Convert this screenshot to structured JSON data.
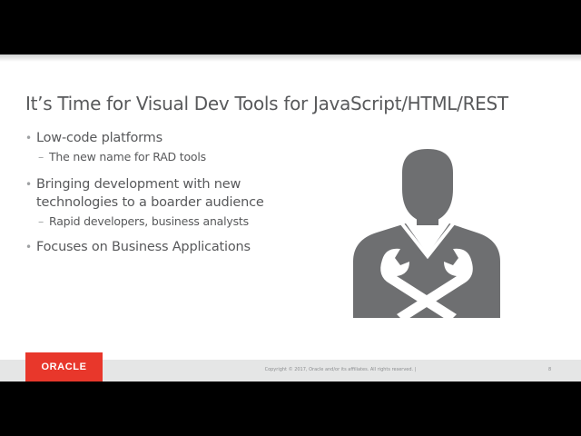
{
  "slide": {
    "title": "It’s Time for Visual Dev Tools for JavaScript/HTML/REST",
    "bullets": [
      {
        "text": "Low-code platforms",
        "sub": "The new name for RAD tools"
      },
      {
        "text_line1": "Bringing development with new",
        "text_line2": "technologies to a boarder audience",
        "sub": "Rapid developers, business analysts"
      },
      {
        "text": "Focuses on Business Applications"
      }
    ],
    "bullet_glyph": "•",
    "sub_glyph": "–",
    "icon": "worker-with-wrenches-icon"
  },
  "footer": {
    "logo_text": "ORACLE",
    "copyright": "Copyright © 2017, Oracle and/or its affiliates. All rights reserved. |",
    "page_number": "8"
  },
  "colors": {
    "text": "#58595b",
    "icon": "#6e6f71",
    "brand_red": "#e8372b",
    "footer_band": "#e5e6e6"
  }
}
